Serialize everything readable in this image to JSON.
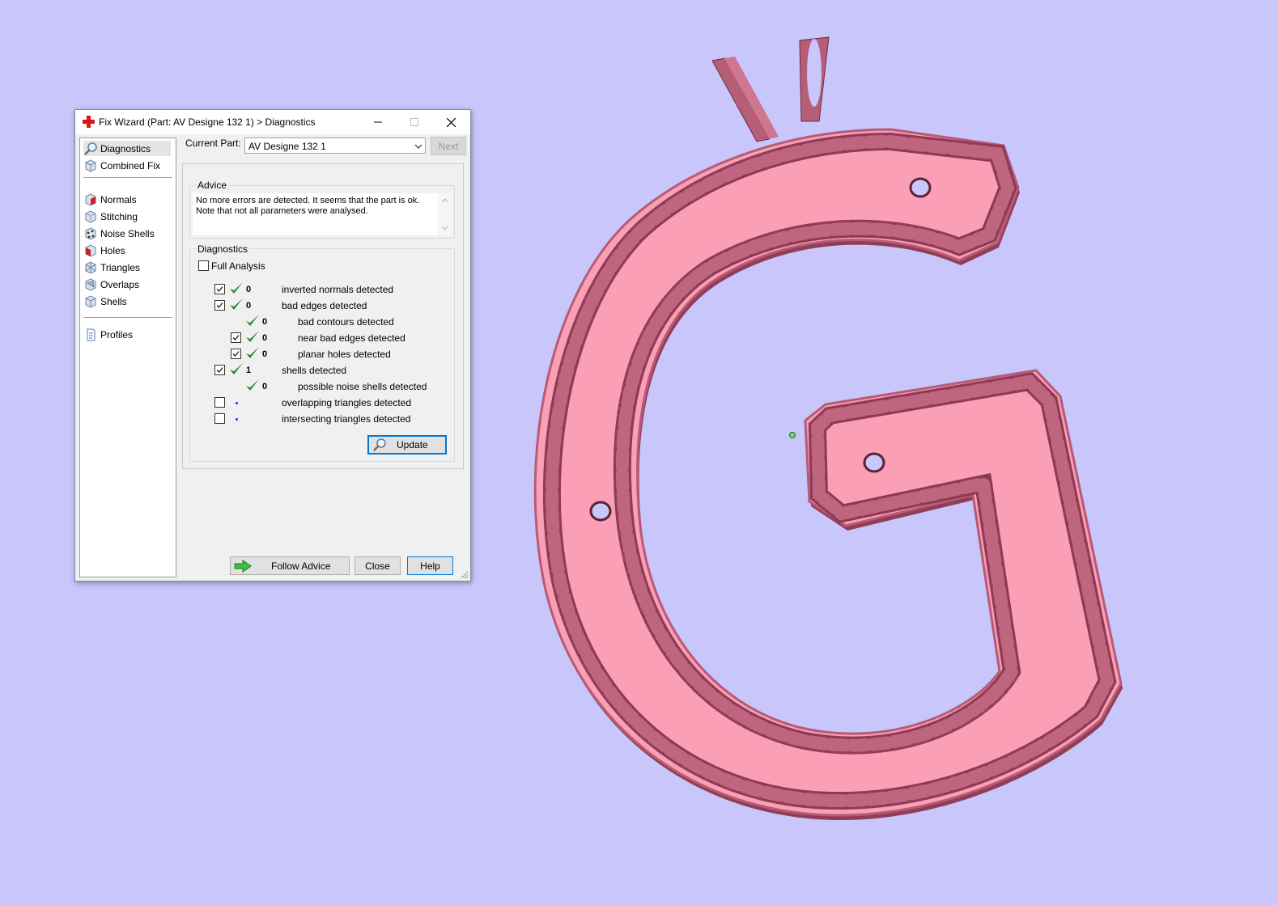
{
  "dialog": {
    "title": "Fix Wizard (Part: AV  Designe 132 1) > Diagnostics",
    "current_part_label": "Current Part:",
    "current_part_value": "AV  Designe 132 1",
    "next_label": "Next",
    "advice_title": "Advice",
    "advice_line1": "No more errors are detected. It seems that the part is ok.",
    "advice_line2": "Note that not all parameters were analysed.",
    "diagnostics_title": "Diagnostics",
    "full_analysis_label": "Full Analysis",
    "update_label": "Update",
    "follow_advice_label": "Follow Advice",
    "close_label": "Close",
    "help_label": "Help"
  },
  "sidebar": {
    "items": [
      {
        "label": "Diagnostics",
        "icon": "magnifier-icon"
      },
      {
        "label": "Combined Fix",
        "icon": "cube-icon"
      },
      {
        "label": "Normals",
        "icon": "normals-icon"
      },
      {
        "label": "Stitching",
        "icon": "stitching-icon"
      },
      {
        "label": "Noise Shells",
        "icon": "noise-shells-icon"
      },
      {
        "label": "Holes",
        "icon": "holes-icon"
      },
      {
        "label": "Triangles",
        "icon": "triangles-icon"
      },
      {
        "label": "Overlaps",
        "icon": "overlaps-icon"
      },
      {
        "label": "Shells",
        "icon": "shells-icon"
      },
      {
        "label": "Profiles",
        "icon": "document-icon"
      }
    ]
  },
  "diagnostics": [
    {
      "checked": true,
      "status": "ok",
      "count": "0",
      "label": "inverted normals detected"
    },
    {
      "checked": true,
      "status": "ok",
      "count": "0",
      "label": "bad edges detected"
    },
    {
      "checked": null,
      "status": "ok",
      "count": "0",
      "label": "bad contours detected"
    },
    {
      "checked": true,
      "status": "ok",
      "count": "0",
      "label": "near bad edges detected"
    },
    {
      "checked": true,
      "status": "ok",
      "count": "0",
      "label": "planar holes detected"
    },
    {
      "checked": true,
      "status": "ok",
      "count": "1",
      "label": "shells detected"
    },
    {
      "checked": null,
      "status": "ok",
      "count": "0",
      "label": "possible noise shells detected"
    },
    {
      "checked": false,
      "status": "pending",
      "count": "",
      "label": "overlapping triangles detected"
    },
    {
      "checked": false,
      "status": "pending",
      "count": "",
      "label": "intersecting triangles detected"
    }
  ],
  "colors": {
    "background": "#c8c6fb",
    "model_face": "#fb9fb6",
    "model_rim": "#c86a83",
    "gem": "#a64d67",
    "ok_tick": "#1f8f3a",
    "accent": "#0078d7"
  }
}
